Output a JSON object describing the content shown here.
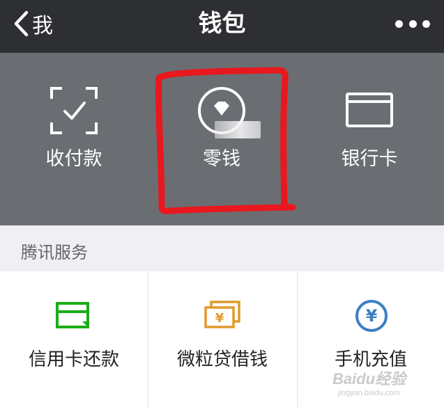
{
  "navbar": {
    "back_label": "我",
    "title": "钱包",
    "back_icon": "chevron-left-icon",
    "more_icon": "more-dots-icon"
  },
  "wallet": {
    "items": [
      {
        "label": "收付款",
        "icon": "scan-check-icon"
      },
      {
        "label": "零钱",
        "icon": "diamond-coin-icon"
      },
      {
        "label": "银行卡",
        "icon": "bank-card-icon"
      }
    ],
    "highlight_color": "#e8181e"
  },
  "services": {
    "section_title": "腾讯服务",
    "items": [
      {
        "label": "信用卡还款",
        "icon": "credit-card-repay-icon",
        "color": "#1aad19"
      },
      {
        "label": "微粒贷借钱",
        "icon": "cash-stack-icon",
        "color": "#e09a2c"
      },
      {
        "label": "手机充值",
        "icon": "yen-circle-icon",
        "color": "#3d7fc4"
      }
    ]
  },
  "watermark": {
    "main": "Baidu经验",
    "sub": "jingyan.baidu.com"
  },
  "colors": {
    "navbar_bg": "#2e2f33",
    "panel_bg": "#6a6d72",
    "section_bg": "#efeff4"
  }
}
